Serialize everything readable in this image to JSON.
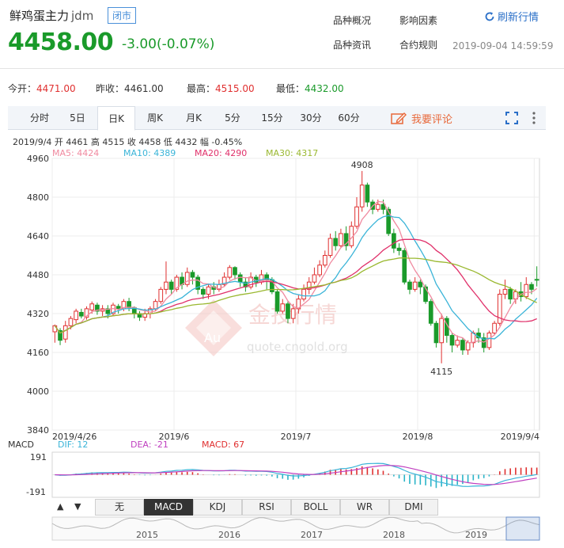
{
  "header": {
    "name": "鲜鸡蛋主力",
    "code": "jdm",
    "status_badge": "闭市",
    "price": "4458.00",
    "change": "-3.00(-0.07%)",
    "links": [
      "品种概况",
      "影响因素",
      "品种资讯",
      "合约规则"
    ],
    "refresh_label": "刷新行情",
    "timestamp": "2019-09-04 14:59:59"
  },
  "stats": {
    "open_label": "今开：",
    "open": "4471.00",
    "prev_close_label": "昨收：",
    "prev_close": "4461.00",
    "high_label": "最高：",
    "high": "4515.00",
    "low_label": "最低：",
    "low": "4432.00"
  },
  "tabs": [
    "分时",
    "5日",
    "日K",
    "周K",
    "月K",
    "5分",
    "15分",
    "30分",
    "60分"
  ],
  "active_tab": "日K",
  "comment_label": "我要评论",
  "colors": {
    "up": "#e03030",
    "down": "#1a9a2a",
    "ma5": "#f08aa0",
    "ma10": "#3ab4d8",
    "ma20": "#e0306a",
    "ma30": "#9ab830"
  },
  "chart_data": {
    "type": "candlestick",
    "info_line": "2019/9/4  开 4461  高 4515  收 4458  低 4432  幅 -0.45%",
    "ma_legend": [
      "MA5: 4424",
      "MA10: 4389",
      "MA20: 4290",
      "MA30: 4317"
    ],
    "y_ticks": [
      3840,
      4000,
      4160,
      4320,
      4480,
      4640,
      4800,
      4960
    ],
    "ylim": [
      3840,
      4960
    ],
    "x_labels": [
      "2019/4/26",
      "2019/6",
      "2019/7",
      "2019/8",
      "2019/9/4"
    ],
    "x_label_index": [
      0,
      23,
      46,
      69,
      91
    ],
    "annotations": [
      {
        "text": "4908",
        "index": 58,
        "value": 4908
      },
      {
        "text": "4115",
        "index": 73,
        "value": 4115
      }
    ],
    "watermark": {
      "main": "金投行情",
      "sub": "quote.cngold.org",
      "logo": "Au"
    },
    "candles": [
      [
        4245,
        4270,
        4200,
        4275
      ],
      [
        4250,
        4210,
        4190,
        4260
      ],
      [
        4215,
        4270,
        4200,
        4290
      ],
      [
        4270,
        4300,
        4255,
        4310
      ],
      [
        4295,
        4330,
        4280,
        4340
      ],
      [
        4325,
        4310,
        4300,
        4340
      ],
      [
        4305,
        4340,
        4295,
        4350
      ],
      [
        4335,
        4360,
        4320,
        4370
      ],
      [
        4355,
        4330,
        4315,
        4365
      ],
      [
        4330,
        4340,
        4310,
        4355
      ],
      [
        4340,
        4320,
        4300,
        4355
      ],
      [
        4320,
        4355,
        4310,
        4365
      ],
      [
        4350,
        4340,
        4320,
        4360
      ],
      [
        4340,
        4370,
        4330,
        4380
      ],
      [
        4370,
        4345,
        4330,
        4385
      ],
      [
        4345,
        4320,
        4300,
        4350
      ],
      [
        4320,
        4305,
        4290,
        4330
      ],
      [
        4305,
        4320,
        4290,
        4340
      ],
      [
        4320,
        4340,
        4300,
        4350
      ],
      [
        4340,
        4370,
        4330,
        4380
      ],
      [
        4370,
        4420,
        4360,
        4430
      ],
      [
        4420,
        4450,
        4400,
        4535
      ],
      [
        4450,
        4420,
        4400,
        4460
      ],
      [
        4420,
        4470,
        4410,
        4480
      ],
      [
        4470,
        4440,
        4420,
        4490
      ],
      [
        4440,
        4490,
        4430,
        4510
      ],
      [
        4490,
        4470,
        4440,
        4500
      ],
      [
        4470,
        4420,
        4400,
        4480
      ],
      [
        4420,
        4400,
        4380,
        4430
      ],
      [
        4400,
        4430,
        4380,
        4440
      ],
      [
        4430,
        4420,
        4400,
        4450
      ],
      [
        4420,
        4440,
        4410,
        4460
      ],
      [
        4440,
        4470,
        4430,
        4490
      ],
      [
        4470,
        4510,
        4460,
        4520
      ],
      [
        4510,
        4480,
        4460,
        4515
      ],
      [
        4480,
        4450,
        4430,
        4490
      ],
      [
        4450,
        4430,
        4410,
        4470
      ],
      [
        4430,
        4470,
        4420,
        4490
      ],
      [
        4470,
        4450,
        4430,
        4480
      ],
      [
        4450,
        4480,
        4440,
        4500
      ],
      [
        4480,
        4460,
        4420,
        4490
      ],
      [
        4460,
        4410,
        4400,
        4470
      ],
      [
        4410,
        4330,
        4320,
        4420
      ],
      [
        4330,
        4360,
        4320,
        4380
      ],
      [
        4360,
        4300,
        4280,
        4370
      ],
      [
        4300,
        4340,
        4280,
        4360
      ],
      [
        4340,
        4380,
        4320,
        4400
      ],
      [
        4380,
        4420,
        4370,
        4440
      ],
      [
        4420,
        4450,
        4400,
        4470
      ],
      [
        4450,
        4480,
        4440,
        4510
      ],
      [
        4480,
        4520,
        4470,
        4540
      ],
      [
        4520,
        4560,
        4510,
        4580
      ],
      [
        4560,
        4630,
        4550,
        4650
      ],
      [
        4630,
        4600,
        4580,
        4660
      ],
      [
        4600,
        4650,
        4590,
        4670
      ],
      [
        4650,
        4600,
        4580,
        4680
      ],
      [
        4600,
        4680,
        4590,
        4700
      ],
      [
        4680,
        4760,
        4670,
        4800
      ],
      [
        4760,
        4850,
        4740,
        4908
      ],
      [
        4850,
        4780,
        4760,
        4860
      ],
      [
        4780,
        4750,
        4730,
        4790
      ],
      [
        4750,
        4770,
        4740,
        4790
      ],
      [
        4770,
        4750,
        4730,
        4790
      ],
      [
        4750,
        4650,
        4640,
        4760
      ],
      [
        4650,
        4590,
        4570,
        4670
      ],
      [
        4590,
        4580,
        4560,
        4610
      ],
      [
        4580,
        4450,
        4440,
        4590
      ],
      [
        4450,
        4420,
        4400,
        4460
      ],
      [
        4420,
        4450,
        4410,
        4470
      ],
      [
        4450,
        4430,
        4400,
        4460
      ],
      [
        4430,
        4370,
        4360,
        4440
      ],
      [
        4370,
        4280,
        4270,
        4380
      ],
      [
        4280,
        4200,
        4180,
        4290
      ],
      [
        4200,
        4300,
        4115,
        4320
      ],
      [
        4300,
        4230,
        4200,
        4310
      ],
      [
        4230,
        4190,
        4160,
        4240
      ],
      [
        4190,
        4210,
        4180,
        4230
      ],
      [
        4210,
        4170,
        4150,
        4220
      ],
      [
        4170,
        4200,
        4150,
        4210
      ],
      [
        4200,
        4240,
        4180,
        4250
      ],
      [
        4240,
        4220,
        4200,
        4260
      ],
      [
        4220,
        4180,
        4160,
        4240
      ],
      [
        4180,
        4240,
        4170,
        4250
      ],
      [
        4240,
        4280,
        4230,
        4290
      ],
      [
        4280,
        4400,
        4270,
        4420
      ],
      [
        4400,
        4420,
        4380,
        4460
      ],
      [
        4420,
        4380,
        4360,
        4430
      ],
      [
        4380,
        4410,
        4360,
        4420
      ],
      [
        4410,
        4390,
        4370,
        4450
      ],
      [
        4390,
        4440,
        4380,
        4470
      ],
      [
        4440,
        4420,
        4400,
        4450
      ],
      [
        4461,
        4458,
        4432,
        4515
      ]
    ],
    "macd": {
      "legend": {
        "title": "MACD",
        "dif": "DIF: 12",
        "dea": "DEA: -21",
        "macd": "MACD: 67"
      },
      "y_ticks": [
        "191",
        "-191"
      ],
      "ylim": [
        -191,
        191
      ]
    },
    "navigator_years": [
      "2015",
      "2016",
      "2017",
      "2018",
      "2019"
    ]
  },
  "indicator_tabs": [
    "无",
    "MACD",
    "KDJ",
    "RSI",
    "BOLL",
    "WR",
    "DMI"
  ],
  "active_indicator": "MACD"
}
